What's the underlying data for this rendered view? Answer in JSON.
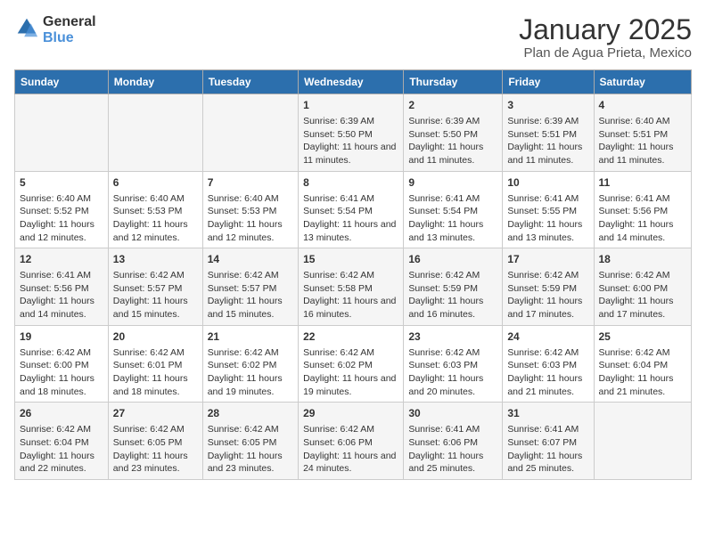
{
  "logo": {
    "text_general": "General",
    "text_blue": "Blue"
  },
  "title": "January 2025",
  "subtitle": "Plan de Agua Prieta, Mexico",
  "days_of_week": [
    "Sunday",
    "Monday",
    "Tuesday",
    "Wednesday",
    "Thursday",
    "Friday",
    "Saturday"
  ],
  "weeks": [
    [
      {
        "day": "",
        "info": ""
      },
      {
        "day": "",
        "info": ""
      },
      {
        "day": "",
        "info": ""
      },
      {
        "day": "1",
        "info": "Sunrise: 6:39 AM\nSunset: 5:50 PM\nDaylight: 11 hours and 11 minutes."
      },
      {
        "day": "2",
        "info": "Sunrise: 6:39 AM\nSunset: 5:50 PM\nDaylight: 11 hours and 11 minutes."
      },
      {
        "day": "3",
        "info": "Sunrise: 6:39 AM\nSunset: 5:51 PM\nDaylight: 11 hours and 11 minutes."
      },
      {
        "day": "4",
        "info": "Sunrise: 6:40 AM\nSunset: 5:51 PM\nDaylight: 11 hours and 11 minutes."
      }
    ],
    [
      {
        "day": "5",
        "info": "Sunrise: 6:40 AM\nSunset: 5:52 PM\nDaylight: 11 hours and 12 minutes."
      },
      {
        "day": "6",
        "info": "Sunrise: 6:40 AM\nSunset: 5:53 PM\nDaylight: 11 hours and 12 minutes."
      },
      {
        "day": "7",
        "info": "Sunrise: 6:40 AM\nSunset: 5:53 PM\nDaylight: 11 hours and 12 minutes."
      },
      {
        "day": "8",
        "info": "Sunrise: 6:41 AM\nSunset: 5:54 PM\nDaylight: 11 hours and 13 minutes."
      },
      {
        "day": "9",
        "info": "Sunrise: 6:41 AM\nSunset: 5:54 PM\nDaylight: 11 hours and 13 minutes."
      },
      {
        "day": "10",
        "info": "Sunrise: 6:41 AM\nSunset: 5:55 PM\nDaylight: 11 hours and 13 minutes."
      },
      {
        "day": "11",
        "info": "Sunrise: 6:41 AM\nSunset: 5:56 PM\nDaylight: 11 hours and 14 minutes."
      }
    ],
    [
      {
        "day": "12",
        "info": "Sunrise: 6:41 AM\nSunset: 5:56 PM\nDaylight: 11 hours and 14 minutes."
      },
      {
        "day": "13",
        "info": "Sunrise: 6:42 AM\nSunset: 5:57 PM\nDaylight: 11 hours and 15 minutes."
      },
      {
        "day": "14",
        "info": "Sunrise: 6:42 AM\nSunset: 5:57 PM\nDaylight: 11 hours and 15 minutes."
      },
      {
        "day": "15",
        "info": "Sunrise: 6:42 AM\nSunset: 5:58 PM\nDaylight: 11 hours and 16 minutes."
      },
      {
        "day": "16",
        "info": "Sunrise: 6:42 AM\nSunset: 5:59 PM\nDaylight: 11 hours and 16 minutes."
      },
      {
        "day": "17",
        "info": "Sunrise: 6:42 AM\nSunset: 5:59 PM\nDaylight: 11 hours and 17 minutes."
      },
      {
        "day": "18",
        "info": "Sunrise: 6:42 AM\nSunset: 6:00 PM\nDaylight: 11 hours and 17 minutes."
      }
    ],
    [
      {
        "day": "19",
        "info": "Sunrise: 6:42 AM\nSunset: 6:00 PM\nDaylight: 11 hours and 18 minutes."
      },
      {
        "day": "20",
        "info": "Sunrise: 6:42 AM\nSunset: 6:01 PM\nDaylight: 11 hours and 18 minutes."
      },
      {
        "day": "21",
        "info": "Sunrise: 6:42 AM\nSunset: 6:02 PM\nDaylight: 11 hours and 19 minutes."
      },
      {
        "day": "22",
        "info": "Sunrise: 6:42 AM\nSunset: 6:02 PM\nDaylight: 11 hours and 19 minutes."
      },
      {
        "day": "23",
        "info": "Sunrise: 6:42 AM\nSunset: 6:03 PM\nDaylight: 11 hours and 20 minutes."
      },
      {
        "day": "24",
        "info": "Sunrise: 6:42 AM\nSunset: 6:03 PM\nDaylight: 11 hours and 21 minutes."
      },
      {
        "day": "25",
        "info": "Sunrise: 6:42 AM\nSunset: 6:04 PM\nDaylight: 11 hours and 21 minutes."
      }
    ],
    [
      {
        "day": "26",
        "info": "Sunrise: 6:42 AM\nSunset: 6:04 PM\nDaylight: 11 hours and 22 minutes."
      },
      {
        "day": "27",
        "info": "Sunrise: 6:42 AM\nSunset: 6:05 PM\nDaylight: 11 hours and 23 minutes."
      },
      {
        "day": "28",
        "info": "Sunrise: 6:42 AM\nSunset: 6:05 PM\nDaylight: 11 hours and 23 minutes."
      },
      {
        "day": "29",
        "info": "Sunrise: 6:42 AM\nSunset: 6:06 PM\nDaylight: 11 hours and 24 minutes."
      },
      {
        "day": "30",
        "info": "Sunrise: 6:41 AM\nSunset: 6:06 PM\nDaylight: 11 hours and 25 minutes."
      },
      {
        "day": "31",
        "info": "Sunrise: 6:41 AM\nSunset: 6:07 PM\nDaylight: 11 hours and 25 minutes."
      },
      {
        "day": "",
        "info": ""
      }
    ]
  ]
}
